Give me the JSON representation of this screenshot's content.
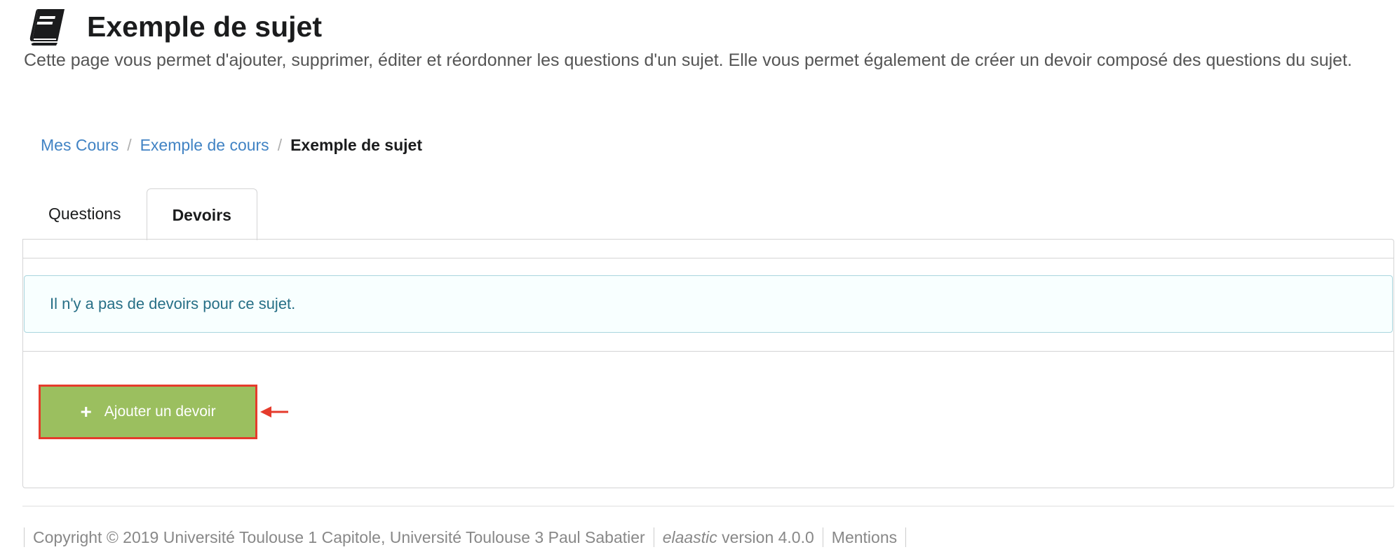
{
  "header": {
    "icon": "book-icon",
    "title": "Exemple de sujet",
    "description": "Cette page vous permet d'ajouter, supprimer, éditer et réordonner les questions d'un sujet. Elle vous permet également de créer un devoir composé des questions du sujet."
  },
  "breadcrumb": {
    "items": [
      {
        "label": "Mes Cours"
      },
      {
        "label": "Exemple de cours"
      },
      {
        "label": "Exemple de sujet"
      }
    ],
    "separator": "/"
  },
  "tabs": [
    {
      "label": "Questions",
      "active": false
    },
    {
      "label": "Devoirs",
      "active": true
    }
  ],
  "devoirs": {
    "empty_message": "Il n'y a pas de devoirs pour ce sujet.",
    "add_button_label": "Ajouter un devoir",
    "add_button_icon": "plus-icon",
    "highlight_color": "#e53b2c",
    "button_color": "#9bbf5f"
  },
  "footer": {
    "copyright": "Copyright © 2019 Université Toulouse 1 Capitole, Université Toulouse 3 Paul Sabatier",
    "app_name": "elaastic",
    "version_text": "version 4.0.0",
    "mentions": "Mentions"
  }
}
